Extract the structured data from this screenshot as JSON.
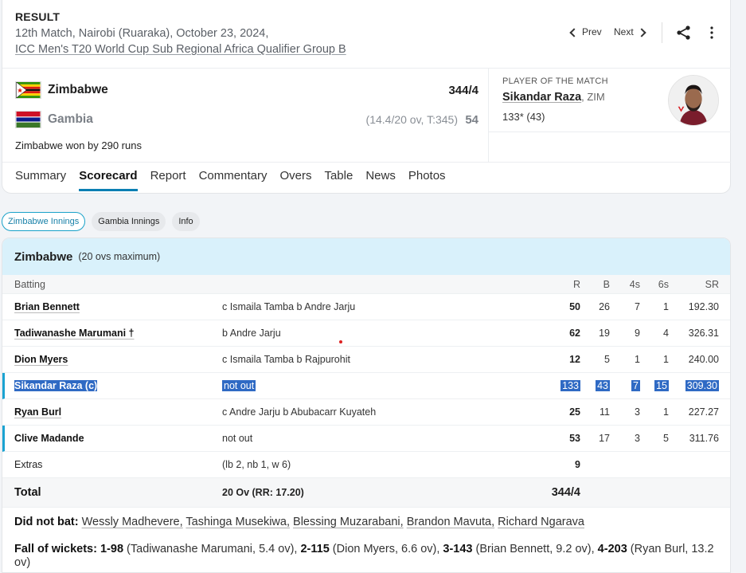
{
  "header": {
    "status": "RESULT",
    "match_info": "12th Match, Nairobi (Ruaraka), October 23, 2024,",
    "series": "ICC Men's T20 World Cup Sub Regional Africa Qualifier Group B",
    "prev": "Prev",
    "next": "Next"
  },
  "teams": [
    {
      "name": "Zimbabwe",
      "overs": "",
      "score": "344/4"
    },
    {
      "name": "Gambia",
      "overs": "(14.4/20 ov, T:345)",
      "score": "54"
    }
  ],
  "result_text": "Zimbabwe won by 290 runs",
  "potm": {
    "label": "PLAYER OF THE MATCH",
    "name": "Sikandar Raza",
    "country": ", ZIM",
    "stat": "133* (43)"
  },
  "tabs": [
    "Summary",
    "Scorecard",
    "Report",
    "Commentary",
    "Overs",
    "Table",
    "News",
    "Photos"
  ],
  "active_tab": "Scorecard",
  "innings_pills": [
    "Zimbabwe Innings",
    "Gambia Innings",
    "Info"
  ],
  "innings": {
    "team": "Zimbabwe",
    "overs_note": "(20 ovs maximum)",
    "header": {
      "batting": "Batting",
      "r": "R",
      "b": "B",
      "fours": "4s",
      "sixes": "6s",
      "sr": "SR"
    },
    "batters": [
      {
        "name": "Brian Bennett",
        "dismissal": "c Ismaila Tamba b Andre Jarju",
        "r": "50",
        "b": "26",
        "fours": "7",
        "sixes": "1",
        "sr": "192.30"
      },
      {
        "name": "Tadiwanashe Marumani †",
        "dismissal": "b Andre Jarju",
        "r": "62",
        "b": "19",
        "fours": "9",
        "sixes": "4",
        "sr": "326.31"
      },
      {
        "name": "Dion Myers",
        "dismissal": "c Ismaila Tamba b Rajpurohit",
        "r": "12",
        "b": "5",
        "fours": "1",
        "sixes": "1",
        "sr": "240.00"
      },
      {
        "name": "Sikandar Raza (c)",
        "dismissal": "not out",
        "r": "133",
        "b": "43",
        "fours": "7",
        "sixes": "15",
        "sr": "309.30"
      },
      {
        "name": "Ryan Burl",
        "dismissal": "c Andre Jarju b Abubacarr Kuyateh",
        "r": "25",
        "b": "11",
        "fours": "3",
        "sixes": "1",
        "sr": "227.27"
      },
      {
        "name": "Clive Madande",
        "dismissal": "not out",
        "r": "53",
        "b": "17",
        "fours": "3",
        "sixes": "5",
        "sr": "311.76"
      }
    ],
    "extras": {
      "label": "Extras",
      "detail": "(lb 2, nb 1, w 6)",
      "value": "9"
    },
    "total": {
      "label": "Total",
      "detail": "20 Ov (RR: 17.20)",
      "value": "344/4"
    },
    "did_not_bat": {
      "label": "Did not bat:",
      "players": [
        "Wessly Madhevere,",
        "Tashinga Musekiwa,",
        "Blessing Muzarabani,",
        "Brandon Mavuta,",
        "Richard Ngarava"
      ]
    },
    "fall_of_wickets": {
      "label": "Fall of wickets:",
      "items": [
        {
          "score": "1-98",
          "detail": "(Tadiwanashe Marumani, 5.4 ov),"
        },
        {
          "score": "2-115",
          "detail": "(Dion Myers, 6.6 ov),"
        },
        {
          "score": "3-143",
          "detail": "(Brian Bennett, 9.2 ov),"
        },
        {
          "score": "4-203",
          "detail": "(Ryan Burl, 13.2 ov)"
        }
      ]
    }
  },
  "colors": {
    "accent": "#0b7fb3",
    "innings_header_bg": "#d9f1fb",
    "selection": "#2f6ac4"
  },
  "icons": [
    "chevron-left-icon",
    "chevron-right-icon",
    "share-icon",
    "more-vertical-icon"
  ]
}
